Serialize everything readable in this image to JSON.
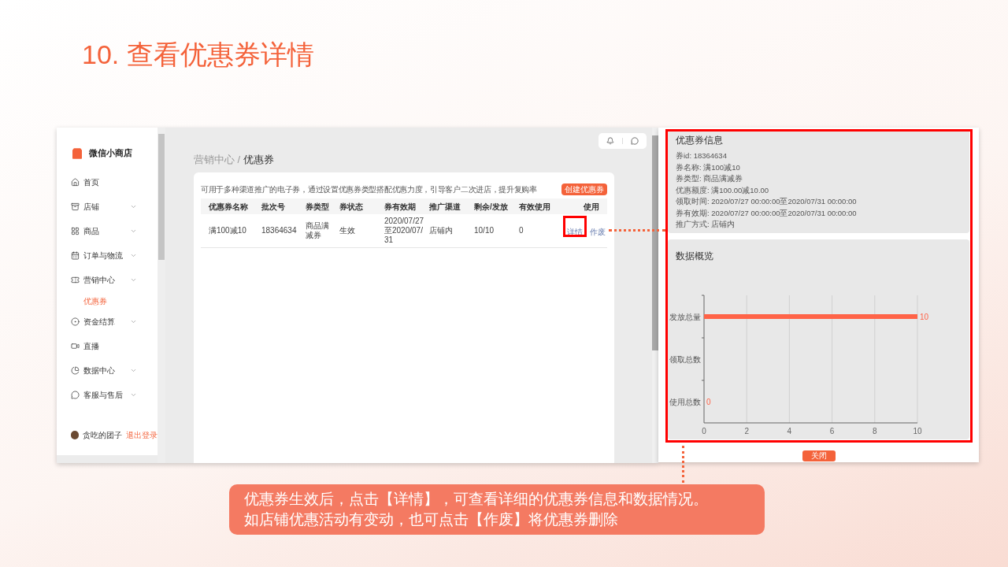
{
  "slide_title": "10. 查看优惠券详情",
  "app": {
    "brand": "微信小商店",
    "nav": [
      {
        "label": "首页",
        "chevron": false
      },
      {
        "label": "店铺",
        "chevron": true
      },
      {
        "label": "商品",
        "chevron": true
      },
      {
        "label": "订单与物流",
        "chevron": true
      },
      {
        "label": "营销中心",
        "chevron": true,
        "children": [
          {
            "label": "优惠券",
            "selected": true
          }
        ]
      },
      {
        "label": "资金结算",
        "chevron": true
      },
      {
        "label": "直播",
        "chevron": false
      },
      {
        "label": "数据中心",
        "chevron": true
      },
      {
        "label": "客服与售后",
        "chevron": true
      }
    ],
    "user": {
      "name": "贪吃的团子",
      "logout": "退出登录"
    },
    "breadcrumb": {
      "parent": "营销中心 / ",
      "current": "优惠券"
    },
    "description": "可用于多种渠道推广的电子券，通过设置优惠券类型搭配优惠力度，引导客户二次进店，提升复购率",
    "create_button": "创建优惠券",
    "table": {
      "columns": [
        "优惠券名称",
        "批次号",
        "券类型",
        "券状态",
        "券有效期",
        "推广渠道",
        "剩余/发放",
        "有效使用",
        "使用"
      ],
      "rows": [
        {
          "cells": [
            "满100减10",
            "18364634",
            "商品满减券",
            "生效",
            "2020/07/27至2020/07/31",
            "店铺内",
            "10/10",
            "0"
          ],
          "actions": [
            "详情",
            "作废"
          ]
        }
      ]
    }
  },
  "detail": {
    "info_title": "优惠券信息",
    "info_lines": [
      "券id: 18364634",
      "券名称: 满100减10",
      "券类型: 商品满减券",
      "优惠额度: 满100.00减10.00",
      "领取时间: 2020/07/27 00:00:00至2020/07/31 00:00:00",
      "券有效期: 2020/07/27 00:00:00至2020/07/31 00:00:00",
      "推广方式: 店铺内"
    ],
    "overview_title": "数据概览",
    "chart_data": {
      "type": "bar",
      "orientation": "horizontal",
      "categories": [
        "发放总量",
        "领取总数",
        "使用总数"
      ],
      "series": [
        {
          "color": "#ff6347",
          "values": [
            10,
            null,
            0
          ]
        }
      ],
      "xlim": [
        0,
        10
      ],
      "xticks": [
        0,
        2,
        4,
        6,
        8,
        10
      ],
      "grid": true,
      "data_labels": true
    },
    "close_button": "关闭"
  },
  "caption": [
    "优惠券生效后，点击【详情】，可查看详细的优惠券信息和数据情况。",
    "如店铺优惠活动有变动，也可点击【作废】将优惠券删除"
  ]
}
